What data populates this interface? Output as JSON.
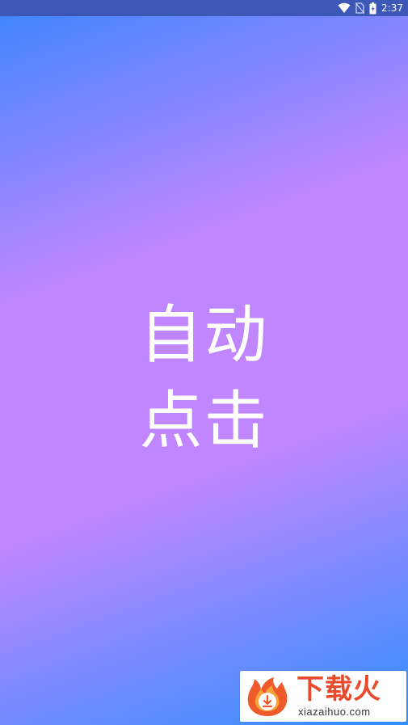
{
  "status_bar": {
    "time": "2:37",
    "icons": [
      "wifi-icon",
      "no-sim-icon",
      "battery-icon"
    ]
  },
  "splash": {
    "line1": "自动",
    "line2": "点击"
  },
  "watermark": {
    "brand": "下载火",
    "url": "xiazaihuo.com",
    "accent": "#e74a2c"
  },
  "colors": {
    "gradient_blue": "#2f8fff",
    "gradient_purple": "#bf86ff",
    "statusbar": "#3d57b6"
  }
}
